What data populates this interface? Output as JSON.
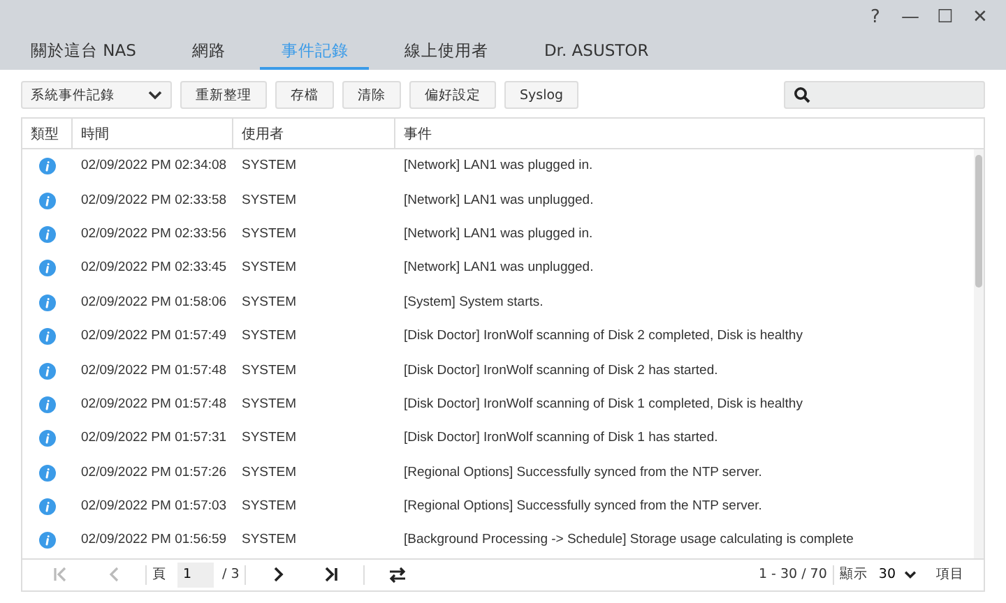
{
  "window": {
    "controls": [
      "?",
      "—",
      "☐",
      "✕"
    ]
  },
  "tabs": [
    {
      "label": "關於這台 NAS",
      "selected": false
    },
    {
      "label": "網路",
      "selected": false
    },
    {
      "label": "事件記錄",
      "selected": true
    },
    {
      "label": "線上使用者",
      "selected": false
    },
    {
      "label": "Dr. ASUSTOR",
      "selected": false
    }
  ],
  "toolbar": {
    "dropdown": "系統事件記錄",
    "buttons": [
      "重新整理",
      "存檔",
      "清除",
      "偏好設定",
      "Syslog"
    ]
  },
  "table": {
    "columns": [
      "類型",
      "時間",
      "使用者",
      "事件"
    ],
    "rows": [
      {
        "kind": "info",
        "time": "02/09/2022 PM 02:34:08",
        "user": "SYSTEM",
        "event": "[Network] LAN1 was plugged in."
      },
      {
        "kind": "info",
        "time": "02/09/2022 PM 02:33:58",
        "user": "SYSTEM",
        "event": "[Network] LAN1 was unplugged."
      },
      {
        "kind": "info",
        "time": "02/09/2022 PM 02:33:56",
        "user": "SYSTEM",
        "event": "[Network] LAN1 was plugged in."
      },
      {
        "kind": "info",
        "time": "02/09/2022 PM 02:33:45",
        "user": "SYSTEM",
        "event": "[Network] LAN1 was unplugged."
      },
      {
        "kind": "info",
        "time": "02/09/2022 PM 01:58:06",
        "user": "SYSTEM",
        "event": "[System] System starts."
      },
      {
        "kind": "info",
        "time": "02/09/2022 PM 01:57:49",
        "user": "SYSTEM",
        "event": "[Disk Doctor] IronWolf scanning of Disk 2 completed, Disk is healthy"
      },
      {
        "kind": "info",
        "time": "02/09/2022 PM 01:57:48",
        "user": "SYSTEM",
        "event": "[Disk Doctor] IronWolf scanning of Disk 2 has started."
      },
      {
        "kind": "info",
        "time": "02/09/2022 PM 01:57:48",
        "user": "SYSTEM",
        "event": "[Disk Doctor] IronWolf scanning of Disk 1 completed, Disk is healthy"
      },
      {
        "kind": "info",
        "time": "02/09/2022 PM 01:57:31",
        "user": "SYSTEM",
        "event": "[Disk Doctor] IronWolf scanning of Disk 1 has started."
      },
      {
        "kind": "info",
        "time": "02/09/2022 PM 01:57:26",
        "user": "SYSTEM",
        "event": "[Regional Options] Successfully synced from the NTP server."
      },
      {
        "kind": "info",
        "time": "02/09/2022 PM 01:57:03",
        "user": "SYSTEM",
        "event": "[Regional Options] Successfully synced from the NTP server."
      },
      {
        "kind": "info",
        "time": "02/09/2022 PM 01:56:59",
        "user": "SYSTEM",
        "event": "[Background Processing -> Schedule] Storage usage calculating is complete"
      }
    ]
  },
  "pager": {
    "first_disabled": true,
    "prev_disabled": true,
    "page_label": "頁",
    "page": "1",
    "total_pages": "/ 3",
    "range": "1 - 30 / 70",
    "show_label": "顯示",
    "per_page": "30",
    "items_label": "項目"
  }
}
